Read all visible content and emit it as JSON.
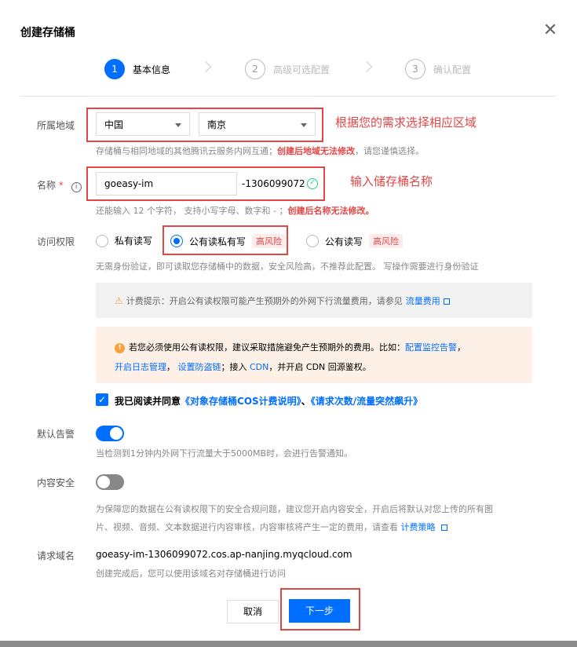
{
  "dialog": {
    "title": "创建存储桶",
    "close_icon": "close-icon"
  },
  "steps": [
    {
      "num": "1",
      "label": "基本信息"
    },
    {
      "num": "2",
      "label": "高级可选配置"
    },
    {
      "num": "3",
      "label": "确认配置"
    }
  ],
  "region": {
    "label": "所属地域",
    "country": "中国",
    "city": "南京",
    "annotation": "根据您的需求选择相应区域",
    "help_prefix": "存储桶与相同地域的其他腾讯云服务内网互通；",
    "help_bold": "创建后地域无法修改",
    "help_suffix": "，请您谨慎选择。"
  },
  "name": {
    "label": "名称",
    "required_mark": "*",
    "info_icon": "info-icon",
    "value": "goeasy-im",
    "suffix": "-1306099072",
    "annotation": "输入储存桶名称",
    "help_prefix": "还能输入 12 个字符， 支持小写字母、数字和 - ；",
    "help_bold": "创建后名称无法修改。"
  },
  "access": {
    "label": "访问权限",
    "options": [
      {
        "label": "私有读写",
        "tag": ""
      },
      {
        "label": "公有读私有写",
        "tag": "高风险"
      },
      {
        "label": "公有读写",
        "tag": "高风险"
      }
    ],
    "selected": "公有读私有写",
    "help": "无需身份验证，即可读取您存储桶中的数据，安全风险高，不推荐此配置。 写操作需要进行身份验证"
  },
  "billing_tip": {
    "text": "计费提示：开启公有读权限可能产生预期外的外网下行流量费用，请参见",
    "link": "流量费用"
  },
  "warning": {
    "line1_text": "若您必须使用公有读权限，建议采取措施避免产生预期外的费用。比如：",
    "line1_link": "配置监控告警",
    "line1_end": "，",
    "line2_link1": "开启日志管理",
    "line2_sep1": "，",
    "line2_link2": "设置防盗链",
    "line2_sep2": "；接入",
    "line2_link3": "CDN",
    "line2_end": "，并开启 CDN 回源鉴权。"
  },
  "agree": {
    "prefix": "我已阅读并同意",
    "link1": "《对象存储桶COS计费说明》",
    "sep": "、",
    "link2": "《请求次数/流量突然飙升》"
  },
  "alarm": {
    "label": "默认告警",
    "state": "on",
    "help": "当检测到1分钟内外网下行流量大于5000MB时，会进行告警通知。"
  },
  "content_security": {
    "label": "内容安全",
    "state": "off",
    "help_line1": "为保障您的数据在公有读权限下的安全合规问题，建议您开启内容安全，开启后将默认对您上传的所有图",
    "help_line2": "片、视频、音频、文本数据进行内容审核，内容审核将产生一定的费用，请查看",
    "help_link": "计费策略"
  },
  "domain": {
    "label": "请求域名",
    "value": "goeasy-im-1306099072.cos.ap-nanjing.myqcloud.com",
    "help": "创建完成后，您可以使用该域名对存储桶进行访问"
  },
  "buttons": {
    "cancel": "取消",
    "next": "下一步"
  }
}
